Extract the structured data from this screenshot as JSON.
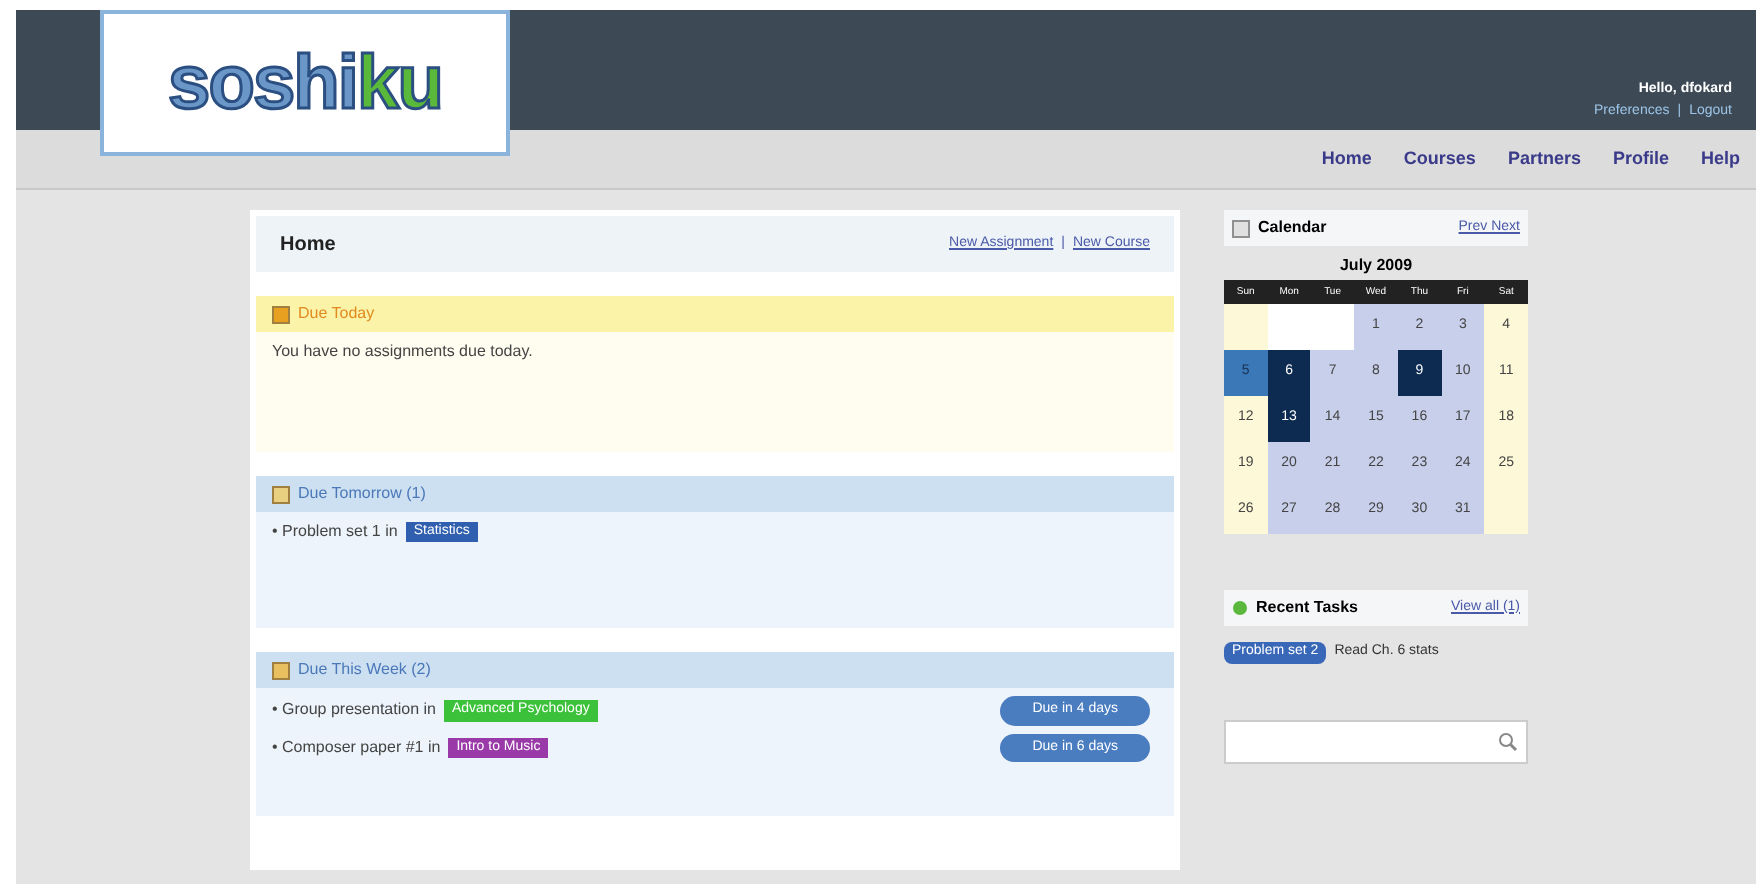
{
  "logo": {
    "part_1": "soshi",
    "part_2": "ku"
  },
  "user": {
    "greeting": "Hello, dfokard",
    "links": [
      "Preferences",
      "Logout"
    ],
    "separator": "|"
  },
  "nav": [
    "Home",
    "Courses",
    "Partners",
    "Profile",
    "Help"
  ],
  "main": {
    "title": "Home",
    "links": [
      "New Assignment",
      "New Course"
    ],
    "separator": "|",
    "sections": [
      {
        "kind": "today",
        "title": "Due Today",
        "empty_text": "You have no assignments due today."
      },
      {
        "kind": "tomorrow",
        "title": "Due Tomorrow (1)",
        "items": [
          {
            "text": "• Problem set 1 in",
            "course": "Statistics",
            "color": "#2f5fae"
          }
        ]
      },
      {
        "kind": "week",
        "title": "Due This Week (2)",
        "items": [
          {
            "text": "• Group presentation in",
            "course": "Advanced Psychology",
            "color": "#3cc23a",
            "due": "Due in 4 days"
          },
          {
            "text": "• Composer paper #1 in",
            "course": "Intro to Music",
            "color": "#9a3aa8",
            "due": "Due in 6 days"
          }
        ]
      }
    ]
  },
  "calendar": {
    "title": "Calendar",
    "nav": "Prev Next",
    "month": "July 2009",
    "weekdays": [
      "Sun",
      "Mon",
      "Tue",
      "Wed",
      "Thu",
      "Fri",
      "Sat"
    ],
    "days": [
      {
        "kind": "blank"
      },
      {
        "kind": "blank"
      },
      {
        "kind": "blank"
      },
      {
        "day": "1",
        "kind": "normal"
      },
      {
        "day": "2",
        "kind": "normal"
      },
      {
        "day": "3",
        "kind": "normal"
      },
      {
        "day": "4",
        "kind": "normal"
      },
      {
        "day": "5",
        "kind": "today"
      },
      {
        "day": "6",
        "kind": "event"
      },
      {
        "day": "7",
        "kind": "normal"
      },
      {
        "day": "8",
        "kind": "normal"
      },
      {
        "day": "9",
        "kind": "event"
      },
      {
        "day": "10",
        "kind": "normal"
      },
      {
        "day": "11",
        "kind": "normal"
      },
      {
        "day": "12",
        "kind": "normal"
      },
      {
        "day": "13",
        "kind": "event"
      },
      {
        "day": "14",
        "kind": "normal"
      },
      {
        "day": "15",
        "kind": "normal"
      },
      {
        "day": "16",
        "kind": "normal"
      },
      {
        "day": "17",
        "kind": "normal"
      },
      {
        "day": "18",
        "kind": "normal"
      },
      {
        "day": "19",
        "kind": "normal"
      },
      {
        "day": "20",
        "kind": "normal"
      },
      {
        "day": "21",
        "kind": "normal"
      },
      {
        "day": "22",
        "kind": "normal"
      },
      {
        "day": "23",
        "kind": "normal"
      },
      {
        "day": "24",
        "kind": "normal"
      },
      {
        "day": "25",
        "kind": "normal"
      },
      {
        "day": "26",
        "kind": "normal"
      },
      {
        "day": "27",
        "kind": "normal"
      },
      {
        "day": "28",
        "kind": "normal"
      },
      {
        "day": "29",
        "kind": "normal"
      },
      {
        "day": "30",
        "kind": "normal"
      },
      {
        "day": "31",
        "kind": "normal"
      },
      {
        "kind": "blank"
      }
    ]
  },
  "recent": {
    "title": "Recent Tasks",
    "link": "View all (1)",
    "items": [
      {
        "tag": "Problem set 2",
        "text": "Read Ch. 6 stats"
      }
    ]
  }
}
